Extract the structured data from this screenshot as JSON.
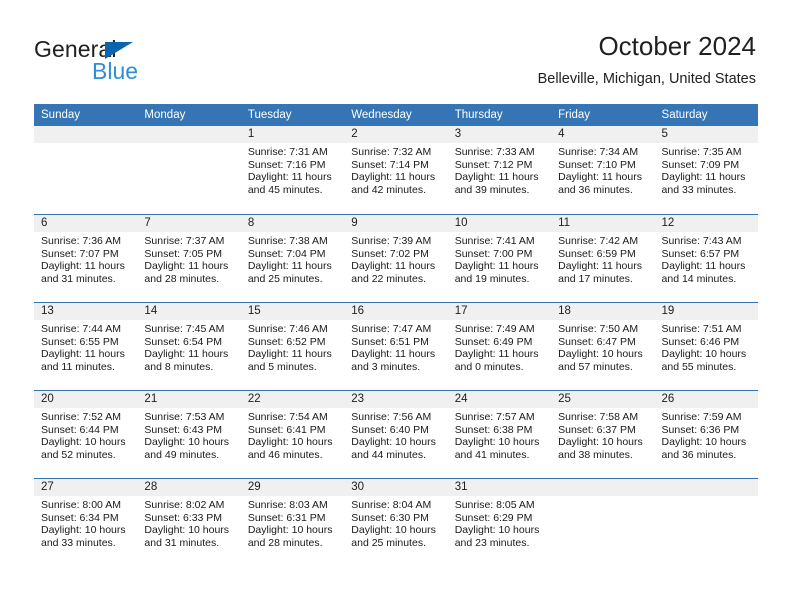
{
  "brand": {
    "name_part1": "General",
    "name_part2": "Blue",
    "triangle_color": "#0a64ad",
    "blue_color": "#2e8fd8"
  },
  "header": {
    "title": "October 2024",
    "subtitle": "Belleville, Michigan, United States",
    "header_bg": "#3575b5",
    "daynum_bg": "#f0f0f0"
  },
  "weekdays": [
    "Sunday",
    "Monday",
    "Tuesday",
    "Wednesday",
    "Thursday",
    "Friday",
    "Saturday"
  ],
  "weeks": [
    [
      {
        "day": "",
        "empty": true,
        "sunrise": "",
        "sunset": "",
        "daylight1": "",
        "daylight2": ""
      },
      {
        "day": "",
        "empty": true,
        "sunrise": "",
        "sunset": "",
        "daylight1": "",
        "daylight2": ""
      },
      {
        "day": "1",
        "sunrise": "Sunrise: 7:31 AM",
        "sunset": "Sunset: 7:16 PM",
        "daylight1": "Daylight: 11 hours",
        "daylight2": "and 45 minutes."
      },
      {
        "day": "2",
        "sunrise": "Sunrise: 7:32 AM",
        "sunset": "Sunset: 7:14 PM",
        "daylight1": "Daylight: 11 hours",
        "daylight2": "and 42 minutes."
      },
      {
        "day": "3",
        "sunrise": "Sunrise: 7:33 AM",
        "sunset": "Sunset: 7:12 PM",
        "daylight1": "Daylight: 11 hours",
        "daylight2": "and 39 minutes."
      },
      {
        "day": "4",
        "sunrise": "Sunrise: 7:34 AM",
        "sunset": "Sunset: 7:10 PM",
        "daylight1": "Daylight: 11 hours",
        "daylight2": "and 36 minutes."
      },
      {
        "day": "5",
        "sunrise": "Sunrise: 7:35 AM",
        "sunset": "Sunset: 7:09 PM",
        "daylight1": "Daylight: 11 hours",
        "daylight2": "and 33 minutes."
      }
    ],
    [
      {
        "day": "6",
        "sunrise": "Sunrise: 7:36 AM",
        "sunset": "Sunset: 7:07 PM",
        "daylight1": "Daylight: 11 hours",
        "daylight2": "and 31 minutes."
      },
      {
        "day": "7",
        "sunrise": "Sunrise: 7:37 AM",
        "sunset": "Sunset: 7:05 PM",
        "daylight1": "Daylight: 11 hours",
        "daylight2": "and 28 minutes."
      },
      {
        "day": "8",
        "sunrise": "Sunrise: 7:38 AM",
        "sunset": "Sunset: 7:04 PM",
        "daylight1": "Daylight: 11 hours",
        "daylight2": "and 25 minutes."
      },
      {
        "day": "9",
        "sunrise": "Sunrise: 7:39 AM",
        "sunset": "Sunset: 7:02 PM",
        "daylight1": "Daylight: 11 hours",
        "daylight2": "and 22 minutes."
      },
      {
        "day": "10",
        "sunrise": "Sunrise: 7:41 AM",
        "sunset": "Sunset: 7:00 PM",
        "daylight1": "Daylight: 11 hours",
        "daylight2": "and 19 minutes."
      },
      {
        "day": "11",
        "sunrise": "Sunrise: 7:42 AM",
        "sunset": "Sunset: 6:59 PM",
        "daylight1": "Daylight: 11 hours",
        "daylight2": "and 17 minutes."
      },
      {
        "day": "12",
        "sunrise": "Sunrise: 7:43 AM",
        "sunset": "Sunset: 6:57 PM",
        "daylight1": "Daylight: 11 hours",
        "daylight2": "and 14 minutes."
      }
    ],
    [
      {
        "day": "13",
        "sunrise": "Sunrise: 7:44 AM",
        "sunset": "Sunset: 6:55 PM",
        "daylight1": "Daylight: 11 hours",
        "daylight2": "and 11 minutes."
      },
      {
        "day": "14",
        "sunrise": "Sunrise: 7:45 AM",
        "sunset": "Sunset: 6:54 PM",
        "daylight1": "Daylight: 11 hours",
        "daylight2": "and 8 minutes."
      },
      {
        "day": "15",
        "sunrise": "Sunrise: 7:46 AM",
        "sunset": "Sunset: 6:52 PM",
        "daylight1": "Daylight: 11 hours",
        "daylight2": "and 5 minutes."
      },
      {
        "day": "16",
        "sunrise": "Sunrise: 7:47 AM",
        "sunset": "Sunset: 6:51 PM",
        "daylight1": "Daylight: 11 hours",
        "daylight2": "and 3 minutes."
      },
      {
        "day": "17",
        "sunrise": "Sunrise: 7:49 AM",
        "sunset": "Sunset: 6:49 PM",
        "daylight1": "Daylight: 11 hours",
        "daylight2": "and 0 minutes."
      },
      {
        "day": "18",
        "sunrise": "Sunrise: 7:50 AM",
        "sunset": "Sunset: 6:47 PM",
        "daylight1": "Daylight: 10 hours",
        "daylight2": "and 57 minutes."
      },
      {
        "day": "19",
        "sunrise": "Sunrise: 7:51 AM",
        "sunset": "Sunset: 6:46 PM",
        "daylight1": "Daylight: 10 hours",
        "daylight2": "and 55 minutes."
      }
    ],
    [
      {
        "day": "20",
        "sunrise": "Sunrise: 7:52 AM",
        "sunset": "Sunset: 6:44 PM",
        "daylight1": "Daylight: 10 hours",
        "daylight2": "and 52 minutes."
      },
      {
        "day": "21",
        "sunrise": "Sunrise: 7:53 AM",
        "sunset": "Sunset: 6:43 PM",
        "daylight1": "Daylight: 10 hours",
        "daylight2": "and 49 minutes."
      },
      {
        "day": "22",
        "sunrise": "Sunrise: 7:54 AM",
        "sunset": "Sunset: 6:41 PM",
        "daylight1": "Daylight: 10 hours",
        "daylight2": "and 46 minutes."
      },
      {
        "day": "23",
        "sunrise": "Sunrise: 7:56 AM",
        "sunset": "Sunset: 6:40 PM",
        "daylight1": "Daylight: 10 hours",
        "daylight2": "and 44 minutes."
      },
      {
        "day": "24",
        "sunrise": "Sunrise: 7:57 AM",
        "sunset": "Sunset: 6:38 PM",
        "daylight1": "Daylight: 10 hours",
        "daylight2": "and 41 minutes."
      },
      {
        "day": "25",
        "sunrise": "Sunrise: 7:58 AM",
        "sunset": "Sunset: 6:37 PM",
        "daylight1": "Daylight: 10 hours",
        "daylight2": "and 38 minutes."
      },
      {
        "day": "26",
        "sunrise": "Sunrise: 7:59 AM",
        "sunset": "Sunset: 6:36 PM",
        "daylight1": "Daylight: 10 hours",
        "daylight2": "and 36 minutes."
      }
    ],
    [
      {
        "day": "27",
        "sunrise": "Sunrise: 8:00 AM",
        "sunset": "Sunset: 6:34 PM",
        "daylight1": "Daylight: 10 hours",
        "daylight2": "and 33 minutes."
      },
      {
        "day": "28",
        "sunrise": "Sunrise: 8:02 AM",
        "sunset": "Sunset: 6:33 PM",
        "daylight1": "Daylight: 10 hours",
        "daylight2": "and 31 minutes."
      },
      {
        "day": "29",
        "sunrise": "Sunrise: 8:03 AM",
        "sunset": "Sunset: 6:31 PM",
        "daylight1": "Daylight: 10 hours",
        "daylight2": "and 28 minutes."
      },
      {
        "day": "30",
        "sunrise": "Sunrise: 8:04 AM",
        "sunset": "Sunset: 6:30 PM",
        "daylight1": "Daylight: 10 hours",
        "daylight2": "and 25 minutes."
      },
      {
        "day": "31",
        "sunrise": "Sunrise: 8:05 AM",
        "sunset": "Sunset: 6:29 PM",
        "daylight1": "Daylight: 10 hours",
        "daylight2": "and 23 minutes."
      },
      {
        "day": "",
        "empty": true,
        "sunrise": "",
        "sunset": "",
        "daylight1": "",
        "daylight2": ""
      },
      {
        "day": "",
        "empty": true,
        "sunrise": "",
        "sunset": "",
        "daylight1": "",
        "daylight2": ""
      }
    ]
  ]
}
